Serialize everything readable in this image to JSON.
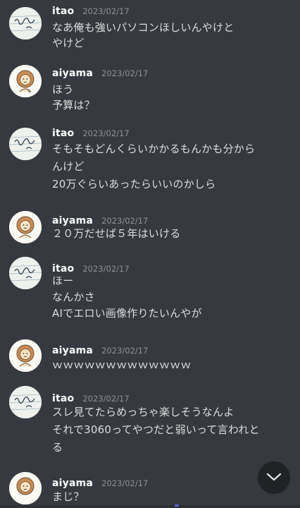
{
  "messages": [
    {
      "user": "itao",
      "timestamp": "2023/02/17",
      "avatar": "itao-notebook-avatar",
      "lines": [
        "なあ俺も強いパソコンほしいんやけと",
        "やけど"
      ]
    },
    {
      "user": "aiyama",
      "timestamp": "2023/02/17",
      "avatar": "aiyama-lion-avatar",
      "lines": [
        "ほう",
        "予算は？"
      ]
    },
    {
      "user": "itao",
      "timestamp": "2023/02/17",
      "avatar": "itao-notebook-avatar",
      "lines": [
        "そもそもどんくらいかかるもんかも分から",
        "んけど",
        "20万ぐらいあったらいいのかしら"
      ]
    },
    {
      "user": "aiyama",
      "timestamp": "2023/02/17",
      "avatar": "aiyama-lion-avatar",
      "lines": [
        "２０万だせば５年はいける"
      ]
    },
    {
      "user": "itao",
      "timestamp": "2023/02/17",
      "avatar": "itao-notebook-avatar",
      "lines": [
        "ほー",
        "なんかさ",
        "AIでエロい画像作りたいんやが"
      ]
    },
    {
      "user": "aiyama",
      "timestamp": "2023/02/17",
      "avatar": "aiyama-lion-avatar",
      "lines": [
        "ｗｗｗｗｗｗｗｗｗｗｗｗｗ"
      ]
    },
    {
      "user": "itao",
      "timestamp": "2023/02/17",
      "avatar": "itao-notebook-avatar",
      "lines": [
        "スレ見てたらめっちゃ楽しそうなんよ",
        "それで3060ってやつだと弱いって言われと",
        "る"
      ]
    },
    {
      "user": "aiyama",
      "timestamp": "2023/02/17",
      "avatar": "aiyama-lion-avatar",
      "lines": [
        "まじ？"
      ]
    }
  ],
  "controls": {
    "scroll_to_bottom_icon": "chevron-down-icon"
  },
  "colors": {
    "background": "#36393f",
    "username": "#ffffff",
    "timestamp": "#8e9297",
    "message_text": "#dcddde",
    "scroll_button": "#202225"
  }
}
